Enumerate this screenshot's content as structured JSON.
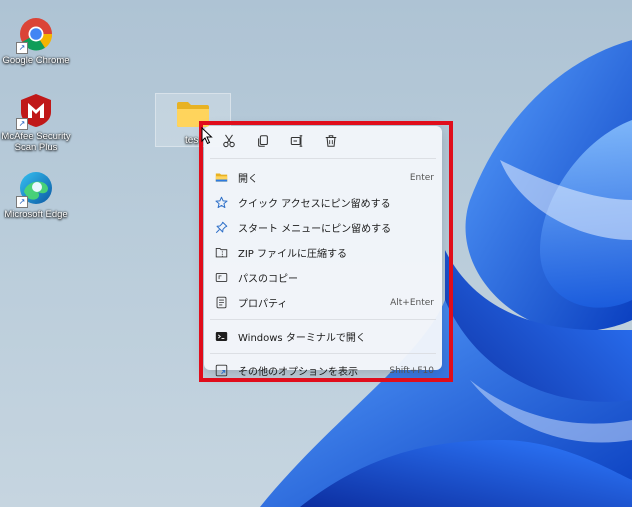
{
  "desktop": {
    "icons": [
      {
        "label": "Google Chrome",
        "icon": "chrome-icon"
      },
      {
        "label": "McAfee Security Scan Plus",
        "icon": "mcafee-icon"
      },
      {
        "label": "Microsoft Edge",
        "icon": "edge-icon"
      }
    ],
    "selected_folder_label": "tes"
  },
  "context_menu": {
    "toolbar": [
      {
        "icon": "cut-icon"
      },
      {
        "icon": "copy-icon"
      },
      {
        "icon": "rename-icon"
      },
      {
        "icon": "delete-icon"
      }
    ],
    "items": [
      {
        "label": "開く",
        "shortcut": "Enter",
        "icon": "folder-open-icon"
      },
      {
        "label": "クイック アクセスにピン留めする",
        "shortcut": "",
        "icon": "star-icon"
      },
      {
        "label": "スタート メニューにピン留めする",
        "shortcut": "",
        "icon": "pin-icon"
      },
      {
        "label": "ZIP ファイルに圧縮する",
        "shortcut": "",
        "icon": "zip-icon"
      },
      {
        "label": "パスのコピー",
        "shortcut": "",
        "icon": "copy-path-icon"
      },
      {
        "label": "プロパティ",
        "shortcut": "Alt+Enter",
        "icon": "properties-icon"
      },
      {
        "label": "Windows ターミナルで開く",
        "shortcut": "",
        "icon": "terminal-icon"
      },
      {
        "label": "その他のオプションを表示",
        "shortcut": "Shift+F10",
        "icon": "more-options-icon"
      }
    ]
  },
  "colors": {
    "highlight_frame": "#e00d1b",
    "wallpaper_blue": "#1f6ff0",
    "accent": "#0067c0"
  }
}
